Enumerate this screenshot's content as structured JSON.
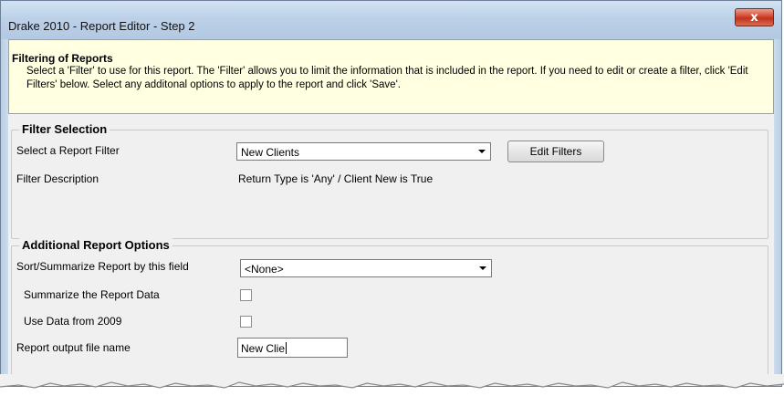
{
  "window": {
    "title": "Drake 2010 - Report Editor - Step 2",
    "close_glyph": "x"
  },
  "info": {
    "heading": "Filtering of Reports",
    "text": "Select a 'Filter' to use for this report. The 'Filter' allows you to limit the information that is included in the report. If you need to edit or create a filter, click 'Edit Filters' below. Select any additonal options to apply to the report and click 'Save'."
  },
  "filter_selection": {
    "legend": "Filter Selection",
    "select_label": "Select a Report Filter",
    "selected_filter": "New Clients",
    "edit_button": "Edit Filters",
    "description_label": "Filter Description",
    "description_value": "Return Type is 'Any' / Client New is True"
  },
  "additional_options": {
    "legend": "Additional Report Options",
    "sort_label": "Sort/Summarize Report by this field",
    "sort_value": "<None>",
    "summarize_label": "Summarize the Report Data",
    "summarize_checked": false,
    "use_data_label": "Use Data from 2009",
    "use_data_checked": false,
    "output_label": "Report output file name",
    "output_value": "New Clie"
  }
}
